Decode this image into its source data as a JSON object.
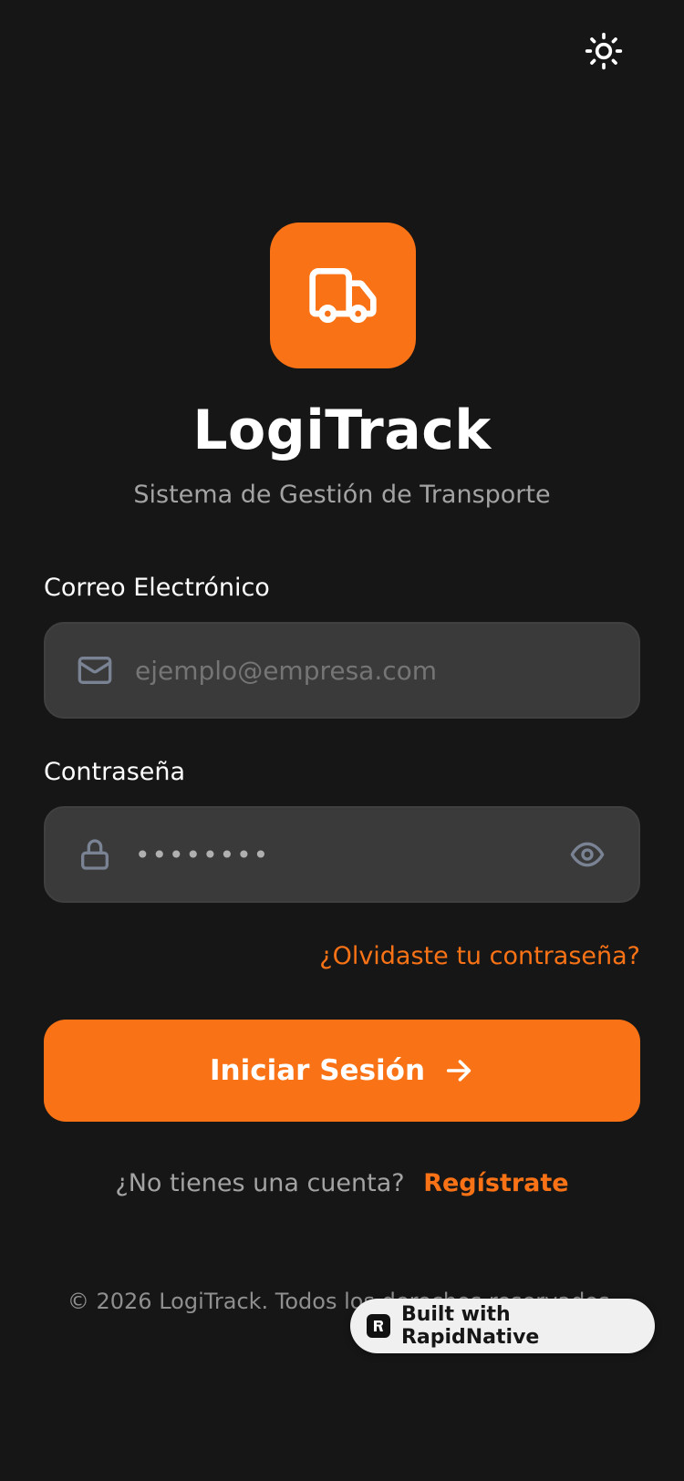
{
  "app": {
    "title": "LogiTrack",
    "subtitle": "Sistema de Gestión de Transporte"
  },
  "header": {
    "theme_icon": "sun-icon"
  },
  "logo": {
    "icon": "truck-icon",
    "color": "#f97316"
  },
  "form": {
    "email_label": "Correo Electrónico",
    "email_placeholder": "ejemplo@empresa.com",
    "email_icon": "mail-icon",
    "password_label": "Contraseña",
    "password_value": "••••••••",
    "password_icon": "lock-icon",
    "password_toggle_icon": "eye-icon",
    "forgot_link": "¿Olvidaste tu contraseña?",
    "submit_label": "Iniciar Sesión",
    "submit_icon": "arrow-right-icon"
  },
  "signup": {
    "prompt": "¿No tienes una cuenta?",
    "link": "Regístrate"
  },
  "footer": {
    "copyright": "© 2026 LogiTrack. Todos los derechos reservados."
  },
  "badge": {
    "label": "Built with RapidNative",
    "icon": "rapidnative-logo-icon"
  },
  "colors": {
    "background": "#161616",
    "accent": "#f97316",
    "input_bg": "#3a3a3a",
    "muted_text": "#a3a3a3"
  }
}
